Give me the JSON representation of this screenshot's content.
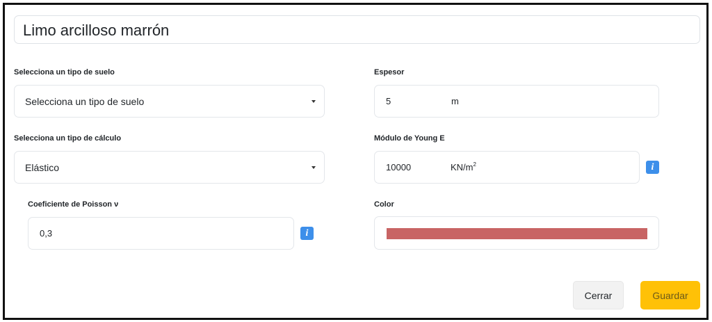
{
  "form": {
    "name_value": "Limo arcilloso marrón",
    "soil_type": {
      "label": "Selecciona un tipo de suelo",
      "selected": "Selecciona un tipo de suelo"
    },
    "calc_type": {
      "label": "Selecciona un tipo de cálculo",
      "selected": "Elástico"
    },
    "poisson": {
      "label": "Coeficiente de Poisson ν",
      "value": "0,3"
    },
    "thickness": {
      "label": "Espesor",
      "value": "5",
      "unit": "m"
    },
    "young": {
      "label": "Módulo de Young E",
      "value": "10000",
      "unit_base": "KN/m",
      "unit_exp": "2"
    },
    "color": {
      "label": "Color",
      "value": "#c86464"
    },
    "info_symbol": "i"
  },
  "buttons": {
    "close_label": "Cerrar",
    "save_label": "Guardar"
  }
}
